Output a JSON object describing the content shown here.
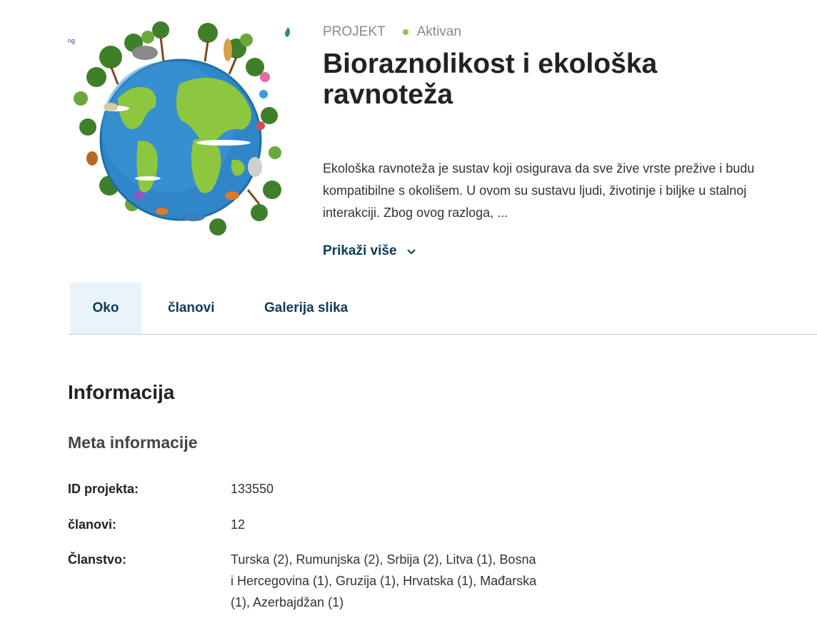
{
  "project": {
    "type_label": "PROJEKT",
    "status_label": "Aktivan",
    "status_color": "#8cc63f",
    "title": "Bioraznolikost i ekološka ravnoteža",
    "description": "Ekološka ravnoteža je sustav koji osigurava da sve žive vrste prežive i budu kompatibilne s okolišem. U ovom su sustavu ljudi, životinje i biljke u stalnoj interakciji. Zbog ovog razloga, ...",
    "show_more_label": "Prikaži više",
    "hero_image": {
      "icon": "earth-biodiversity-illustration",
      "corner_text": "ng"
    }
  },
  "tabs": [
    {
      "label": "Oko",
      "active": true
    },
    {
      "label": "članovi",
      "active": false
    },
    {
      "label": "Galerija slika",
      "active": false
    }
  ],
  "info": {
    "section_title": "Informacija",
    "subsection_title": "Meta informacije",
    "rows": [
      {
        "label": "ID projekta:",
        "value": "133550"
      },
      {
        "label": "članovi:",
        "value": "12"
      },
      {
        "label": "Članstvo:",
        "value": "Turska (2), Rumunjska (2), Srbija (2), Litva (1), Bosna i Hercegovina (1), Gruzija (1), Hrvatska (1), Mađarska (1), Azerbajdžan (1)"
      }
    ]
  },
  "colors": {
    "accent": "#0d3b58",
    "tab_active_bg": "#e9f3fa",
    "muted_text": "#8a8a8a"
  }
}
